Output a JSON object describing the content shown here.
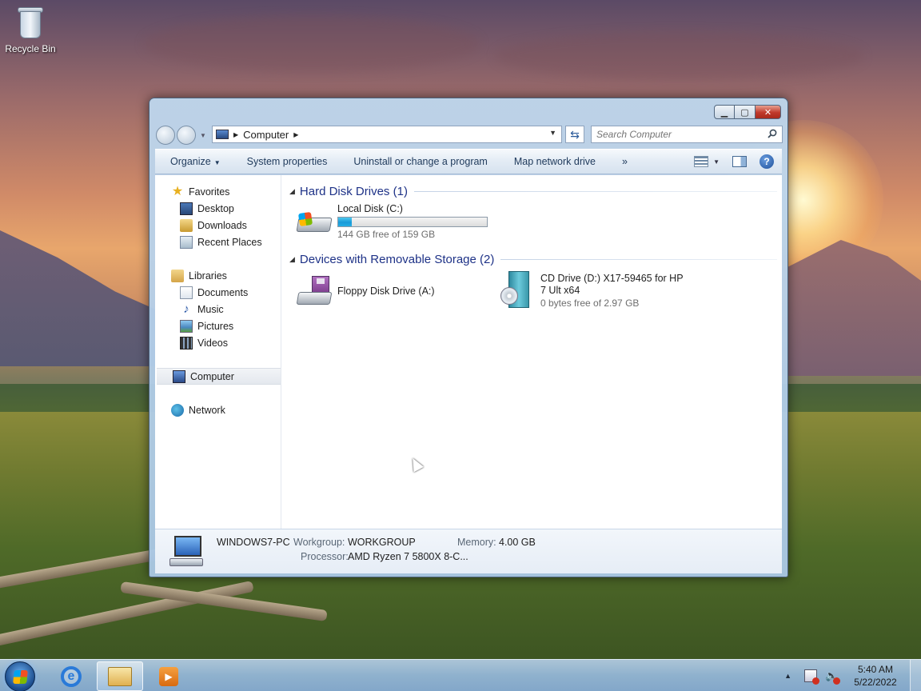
{
  "desktop": {
    "recycle_bin_label": "Recycle Bin"
  },
  "window": {
    "address": {
      "crumb": "Computer",
      "search_placeholder": "Search Computer"
    },
    "toolbar": {
      "organize": "Organize",
      "system_properties": "System properties",
      "uninstall": "Uninstall or change a program",
      "map_drive": "Map network drive",
      "more": "»"
    },
    "nav": {
      "favorites": "Favorites",
      "desktop": "Desktop",
      "downloads": "Downloads",
      "recent_places": "Recent Places",
      "libraries": "Libraries",
      "documents": "Documents",
      "music": "Music",
      "pictures": "Pictures",
      "videos": "Videos",
      "computer": "Computer",
      "network": "Network"
    },
    "groups": {
      "hdd_title": "Hard Disk Drives (1)",
      "removable_title": "Devices with Removable Storage (2)"
    },
    "drives": {
      "local_disk": {
        "name": "Local Disk (C:)",
        "free": "144 GB free of 159 GB",
        "used_fraction": 0.094
      },
      "floppy": {
        "name": "Floppy Disk Drive (A:)"
      },
      "cd": {
        "name": "CD Drive (D:) X17-59465 for HP 7 Ult x64",
        "free": "0 bytes free of 2.97 GB"
      }
    },
    "details": {
      "pc_name": "WINDOWS7-PC",
      "workgroup_label": "Workgroup:",
      "workgroup_value": "WORKGROUP",
      "memory_label": "Memory:",
      "memory_value": "4.00 GB",
      "processor_label": "Processor:",
      "processor_value": "AMD Ryzen 7 5800X 8-C..."
    }
  },
  "taskbar": {
    "clock_time": "5:40 AM",
    "clock_date": "5/22/2022"
  },
  "colors": {
    "group_header": "#1e3287",
    "disk_fill": "#1a9ad8",
    "toolbar_text": "#1e395b"
  }
}
